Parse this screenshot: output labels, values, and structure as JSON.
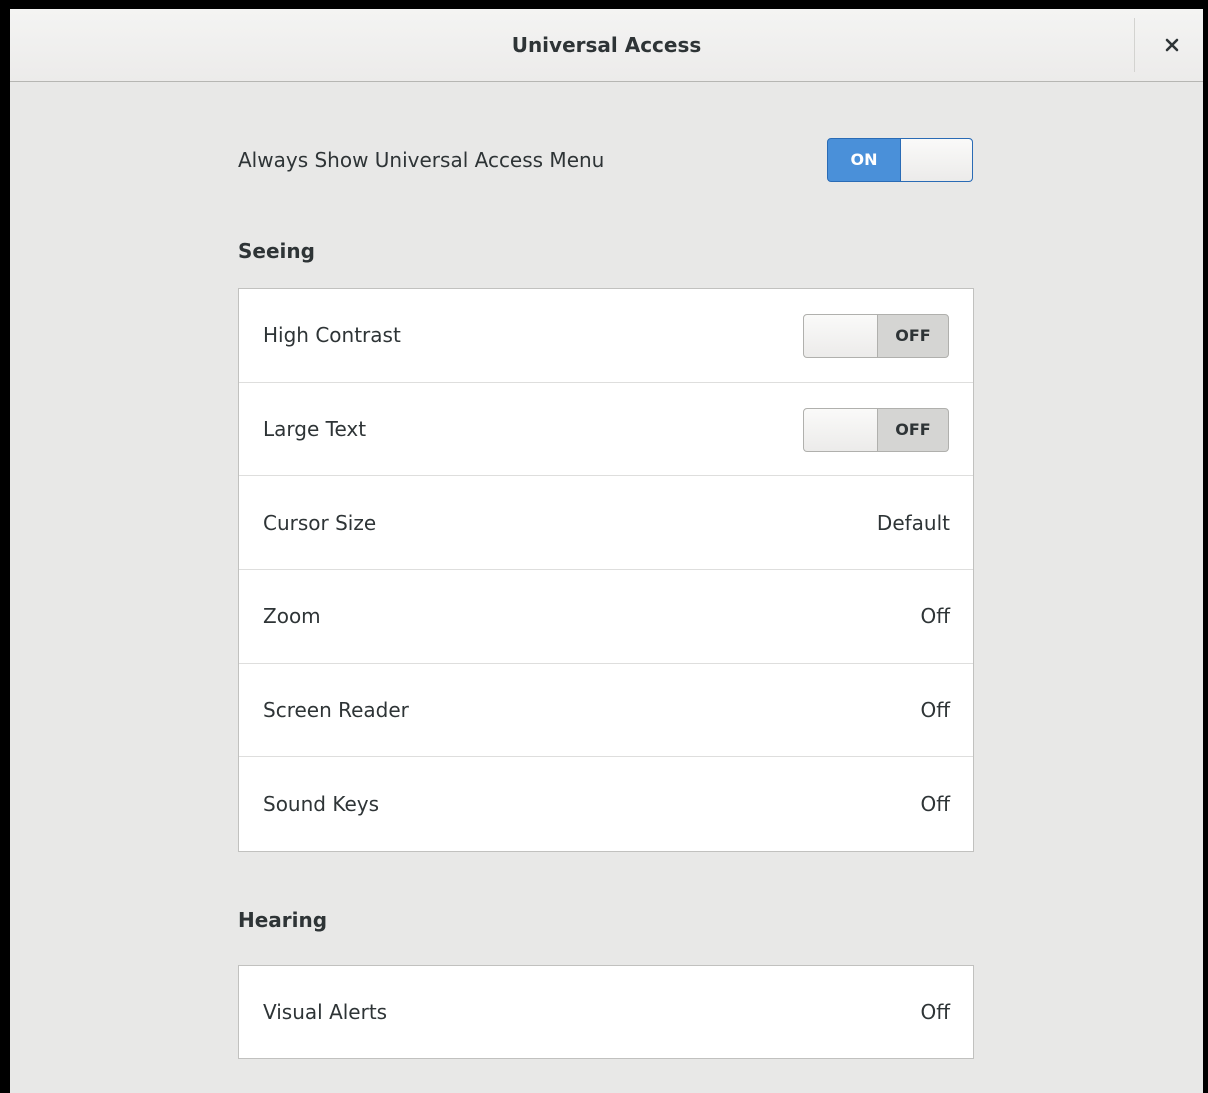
{
  "window": {
    "title": "Universal Access",
    "close_icon": "close-icon"
  },
  "always_show": {
    "label": "Always Show Universal Access Menu",
    "state": "ON",
    "enabled": true,
    "accent_color": "#4a90d9"
  },
  "seeing": {
    "heading": "Seeing",
    "rows": [
      {
        "label": "High Contrast",
        "switch_text": "OFF",
        "enabled": false
      },
      {
        "label": "Large Text",
        "switch_text": "OFF",
        "enabled": false
      },
      {
        "label": "Cursor Size",
        "value": "Default"
      },
      {
        "label": "Zoom",
        "value": "Off"
      },
      {
        "label": "Screen Reader",
        "value": "Off"
      },
      {
        "label": "Sound Keys",
        "value": "Off"
      }
    ]
  },
  "hearing": {
    "heading": "Hearing",
    "rows": [
      {
        "label": "Visual Alerts",
        "value": "Off"
      }
    ]
  }
}
